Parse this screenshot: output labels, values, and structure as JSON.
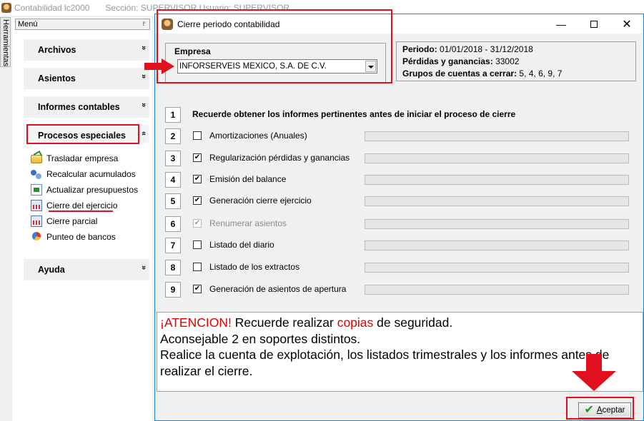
{
  "main_window": {
    "app_title": "Contabilidad lc2000",
    "section_text": "Sección: SUPERVISOR Usuario: SUPERVISOR"
  },
  "sidebar": {
    "tools_tab": "Herramientas",
    "menu_header": "Menú",
    "pin_glyph": "♇",
    "groups": [
      {
        "label": "Archivos",
        "chevron": "»"
      },
      {
        "label": "Asientos",
        "chevron": "»"
      },
      {
        "label": "Informes contables",
        "chevron": "»"
      },
      {
        "label": "Procesos especiales",
        "chevron": "«"
      },
      {
        "label": "Ayuda",
        "chevron": "»"
      }
    ],
    "sub_items": [
      {
        "label": "Trasladar empresa",
        "icon": "folder-icon"
      },
      {
        "label": "Recalcular acumulados",
        "icon": "dots-icon"
      },
      {
        "label": "Actualizar presupuestos",
        "icon": "sheet-icon"
      },
      {
        "label": "Cierre del ejercicio",
        "icon": "calculator-icon"
      },
      {
        "label": "Cierre parcial",
        "icon": "calculator-icon"
      },
      {
        "label": "Punteo de bancos",
        "icon": "pie-chart-icon"
      }
    ]
  },
  "dialog": {
    "title": "Cierre periodo contabilidad",
    "min_glyph": "—",
    "close_glyph": "✕",
    "empresa": {
      "label": "Empresa",
      "value": "INFORSERVEIS MEXICO, S.A. DE C.V."
    },
    "info": {
      "periodo_label": "Periodo:",
      "periodo_value": "01/01/2018 - 31/12/2018",
      "perdidas_label": "Pérdidas y ganancias:",
      "perdidas_value": "33002",
      "grupos_label": "Grupos de cuentas a cerrar:",
      "grupos_value": "5, 4, 6, 9, 7"
    },
    "steps": [
      {
        "num": "1",
        "label": "Recuerde obtener los informes pertinentes antes de iniciar el proceso de cierre",
        "type": "title"
      },
      {
        "num": "2",
        "label": "Amortizaciones (Anuales)",
        "checked": false,
        "disabled": false
      },
      {
        "num": "3",
        "label": "Regularización pérdidas y ganancias",
        "checked": true,
        "disabled": false
      },
      {
        "num": "4",
        "label": "Emisión del balance",
        "checked": true,
        "disabled": false
      },
      {
        "num": "5",
        "label": "Generación cierre ejercicio",
        "checked": true,
        "disabled": false
      },
      {
        "num": "6",
        "label": "Renumerar asientos",
        "checked": true,
        "disabled": true
      },
      {
        "num": "7",
        "label": "Listado del diario",
        "checked": false,
        "disabled": false
      },
      {
        "num": "8",
        "label": "Listado de los extractos",
        "checked": false,
        "disabled": false
      },
      {
        "num": "9",
        "label": "Generación de asientos de apertura",
        "checked": true,
        "disabled": false
      }
    ],
    "check_glyph": "✔",
    "notice": {
      "attention": "¡ATENCION!",
      "part1": " Recuerde realizar ",
      "copias": "copias",
      "part2": " de seguridad.",
      "line2": "Aconsejable 2 en soportes distintos.",
      "line3": "Realice la cuenta de explotación, los listados trimestrales y los informes antes de realizar el cierre."
    },
    "accept_button": {
      "tick_glyph": "✔",
      "accel": "A",
      "rest": "ceptar"
    }
  },
  "colors": {
    "annotation_red": "#e0101f",
    "dialog_border": "#1883d7",
    "notice_red": "#e00000"
  }
}
